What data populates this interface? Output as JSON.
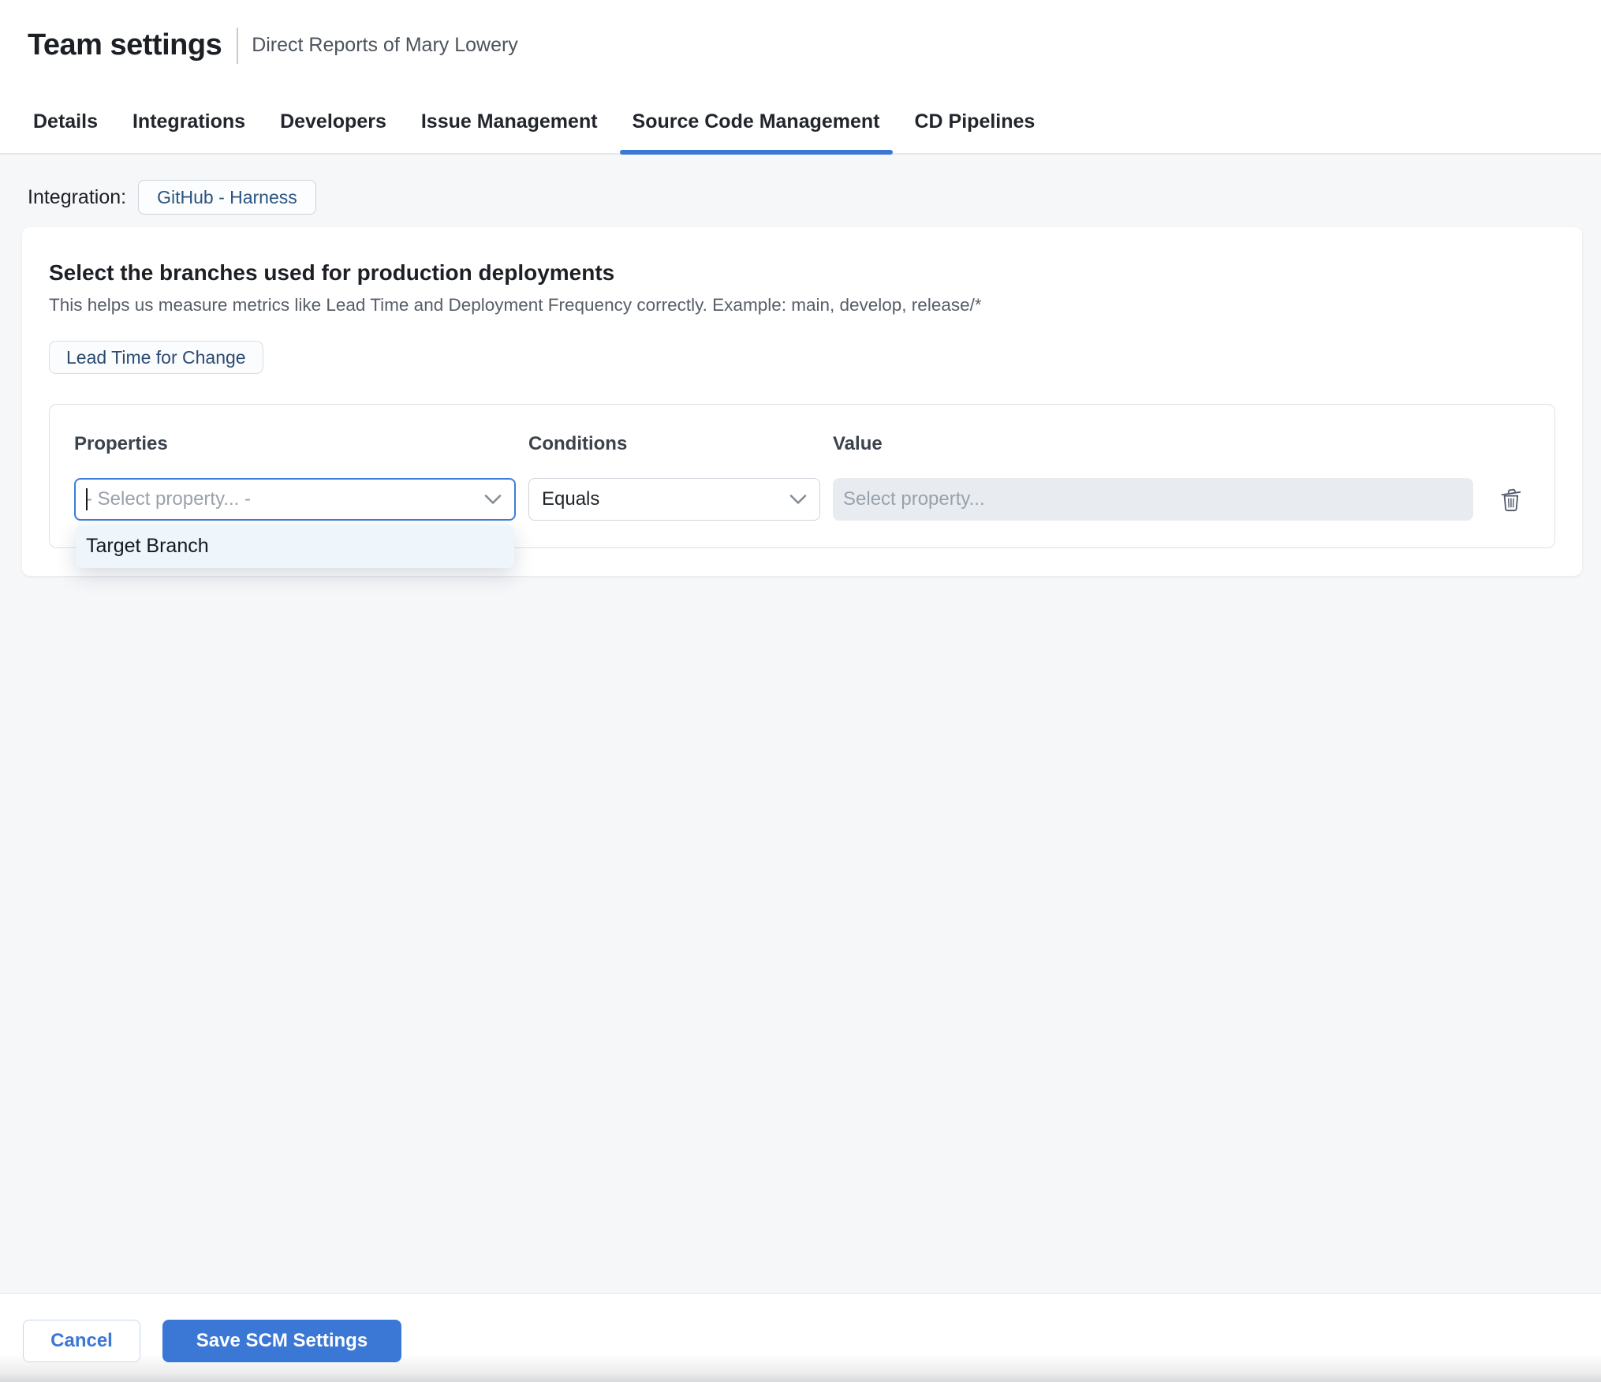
{
  "colors": {
    "accent": "#3B77D5",
    "page_background": "#F6F7F9",
    "integration_chip_text": "#2B5381",
    "metric_chip_text": "#2B4A70",
    "placeholder_text": "#99A1AB",
    "disabled_input_background": "#E8ECF0",
    "dropdown_menu_background": "#EEF6FB"
  },
  "header": {
    "title": "Team settings",
    "subtitle": "Direct Reports of Mary Lowery"
  },
  "tabs": [
    {
      "label": "Details"
    },
    {
      "label": "Integrations"
    },
    {
      "label": "Developers"
    },
    {
      "label": "Issue Management"
    },
    {
      "label": "Source Code Management"
    },
    {
      "label": "CD Pipelines"
    }
  ],
  "integration": {
    "label": "Integration:",
    "value": "GitHub - Harness"
  },
  "scm_card": {
    "title": "Select the branches used for production deployments",
    "subtitle": "This helps us measure metrics like Lead Time and Deployment Frequency correctly. Example: main, develop, release/*",
    "metric_chip": "Lead Time for Change",
    "rule_builder": {
      "properties_label": "Properties",
      "conditions_label": "Conditions",
      "value_label": "Value",
      "property_placeholder": "- Select property... -",
      "condition_selected": "Equals",
      "value_placeholder": "Select property...",
      "property_options": [
        "Target Branch"
      ]
    }
  },
  "footer": {
    "cancel": "Cancel",
    "save": "Save SCM Settings"
  },
  "icons": {
    "property_dropdown": "chevron-down-icon",
    "condition_dropdown": "chevron-down-icon",
    "delete_rule": "trash-icon"
  }
}
